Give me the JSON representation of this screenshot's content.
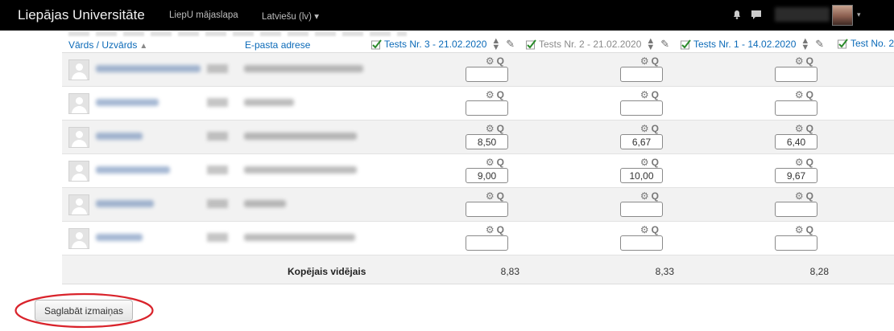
{
  "navbar": {
    "brand": "Liepājas Universitāte",
    "home_link": "LiepU mājaslapa",
    "language": "Latviešu (lv)",
    "language_caret": "▾",
    "user_caret": "▾"
  },
  "table": {
    "name_header": "Vārds / Uzvārds",
    "name_sort": "▲",
    "email_header": "E-pasta adrese",
    "columns": [
      {
        "label": "Tests Nr. 3 - 21.02.2020"
      },
      {
        "label": "Tests Nr. 2 - 21.02.2020"
      },
      {
        "label": "Tests Nr. 1 - 14.02.2020"
      },
      {
        "label": "Test No. 2"
      }
    ],
    "rows": [
      {
        "grades": [
          "",
          "",
          ""
        ]
      },
      {
        "grades": [
          "",
          "",
          ""
        ]
      },
      {
        "grades": [
          "8,50",
          "6,67",
          "6,40"
        ]
      },
      {
        "grades": [
          "9,00",
          "10,00",
          "9,67"
        ]
      },
      {
        "grades": [
          "",
          "",
          ""
        ]
      },
      {
        "grades": [
          "",
          "",
          ""
        ]
      }
    ],
    "average_label": "Kopējais vidējais",
    "averages": [
      "8,83",
      "8,33",
      "8,28"
    ]
  },
  "save_button": "Saglabāt izmaiņas",
  "colors": {
    "navbar_bg": "#000000",
    "link_blue": "#0b6ab8",
    "row_alt": "#f2f2f2",
    "highlight": "#d9232b"
  },
  "icons": {
    "grade_actions": "⚙🔍",
    "pencil": "✎",
    "sort": "⇕"
  }
}
